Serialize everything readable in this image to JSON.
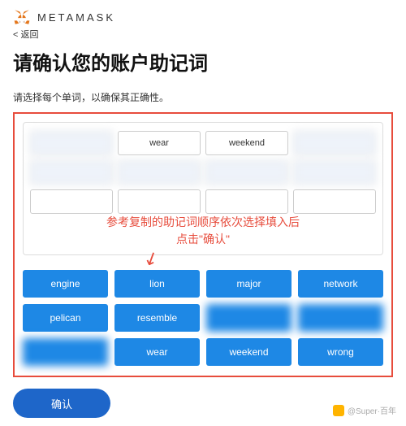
{
  "brand": "METAMASK",
  "back_label": "< 返回",
  "title": "请确认您的账户助记词",
  "subtitle": "请选择每个单词，以确保其正确性。",
  "slots": [
    {
      "text": "",
      "blur": true
    },
    {
      "text": "wear",
      "blur": false
    },
    {
      "text": "weekend",
      "blur": false
    },
    {
      "text": "",
      "blur": true
    },
    {
      "text": "",
      "blur": true
    },
    {
      "text": "",
      "blur": true
    },
    {
      "text": "",
      "blur": true
    },
    {
      "text": "",
      "blur": true
    },
    {
      "text": "",
      "blur": false
    },
    {
      "text": "",
      "blur": false
    },
    {
      "text": "",
      "blur": false
    },
    {
      "text": "",
      "blur": false
    }
  ],
  "overlay_line1": "参考复制的助记词顺序依次选择填入后",
  "overlay_line2": "点击\"确认\"",
  "words": [
    {
      "text": "engine",
      "blur": false
    },
    {
      "text": "lion",
      "blur": false
    },
    {
      "text": "major",
      "blur": false
    },
    {
      "text": "network",
      "blur": false
    },
    {
      "text": "pelican",
      "blur": false
    },
    {
      "text": "resemble",
      "blur": false
    },
    {
      "text": "",
      "blur": true
    },
    {
      "text": "",
      "blur": true
    },
    {
      "text": "",
      "blur": true
    },
    {
      "text": "wear",
      "blur": false
    },
    {
      "text": "weekend",
      "blur": false
    },
    {
      "text": "wrong",
      "blur": false
    }
  ],
  "confirm_label": "确认",
  "watermark": "@Super·百年"
}
